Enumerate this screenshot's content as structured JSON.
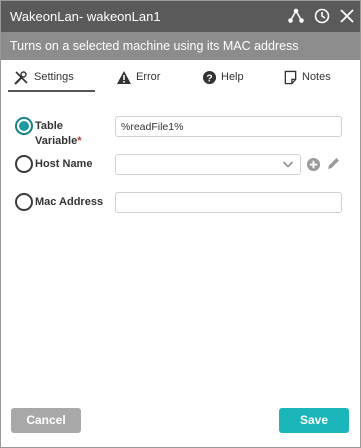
{
  "window": {
    "title": "WakeonLan-  wakeonLan1",
    "subtitle": "Turns on a selected machine using its MAC address"
  },
  "tabs": [
    {
      "label": "Settings",
      "icon": "tools-icon",
      "active": true
    },
    {
      "label": "Error",
      "icon": "warning-icon"
    },
    {
      "label": "Help",
      "icon": "help-icon"
    },
    {
      "label": "Notes",
      "icon": "notes-icon"
    }
  ],
  "form": {
    "table_variable": {
      "label_line1": "Table",
      "label_line2": "Variable",
      "required_mark": "*",
      "value": "%readFile1%",
      "selected": true
    },
    "host_name": {
      "label": "Host Name",
      "value": ""
    },
    "mac_address": {
      "label": "Mac Address",
      "value": ""
    }
  },
  "buttons": {
    "cancel": "Cancel",
    "save": "Save"
  },
  "colors": {
    "title_bg": "#5a5a5a",
    "subtitle_bg": "#8c8c8c",
    "accent": "#1ab5b8",
    "cancel": "#a8a8a8"
  }
}
